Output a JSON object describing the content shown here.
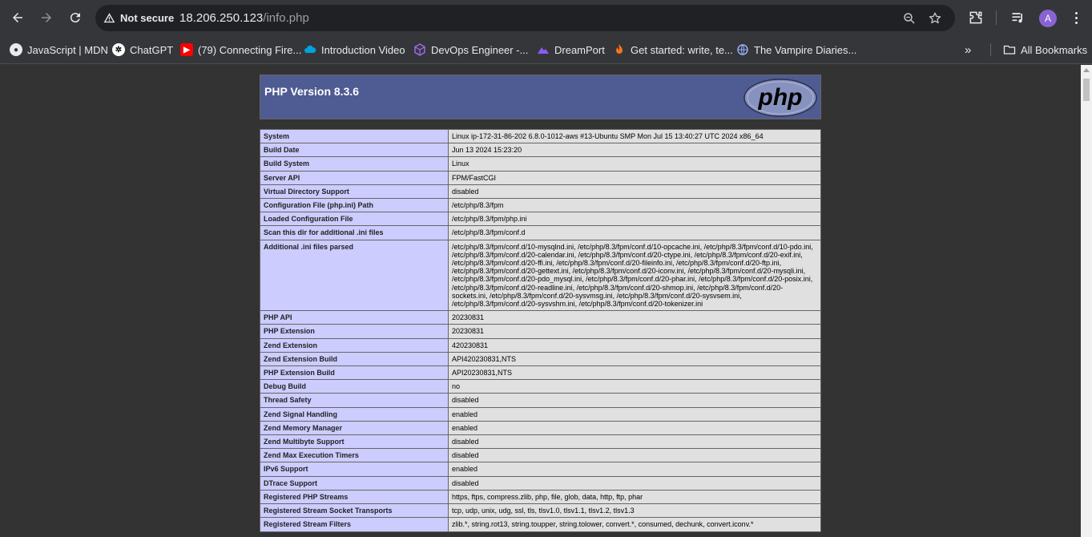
{
  "browser": {
    "security_label": "Not secure",
    "url_host": "18.206.250.123",
    "url_path": "/info.php",
    "avatar_letter": "A",
    "all_bookmarks_label": "All Bookmarks",
    "bookmarks": [
      {
        "label": "JavaScript | MDN",
        "icon": "mdn-icon"
      },
      {
        "label": "ChatGPT",
        "icon": "chatgpt-icon"
      },
      {
        "label": "(79) Connecting Fire...",
        "icon": "youtube-icon"
      },
      {
        "label": "Introduction Video",
        "icon": "cloud-icon"
      },
      {
        "label": "DevOps Engineer -...",
        "icon": "cube-icon"
      },
      {
        "label": "DreamPort",
        "icon": "mountain-icon"
      },
      {
        "label": "Get started: write, te...",
        "icon": "flame-icon"
      },
      {
        "label": "The Vampire Diaries...",
        "icon": "globe-icon"
      }
    ],
    "colors": {
      "chrome": "#35363a",
      "omnibox": "#202124",
      "page_bg": "#333333"
    }
  },
  "phpinfo": {
    "title": "PHP Version 8.3.6",
    "logo_text": "php",
    "colors": {
      "header": "#4f5b93",
      "key_cell": "#ccccff",
      "value_cell": "#e0e0e0"
    },
    "rows": [
      {
        "key": "System",
        "value": "Linux ip-172-31-86-202 6.8.0-1012-aws #13-Ubuntu SMP Mon Jul 15 13:40:27 UTC 2024 x86_64"
      },
      {
        "key": "Build Date",
        "value": "Jun 13 2024 15:23:20"
      },
      {
        "key": "Build System",
        "value": "Linux"
      },
      {
        "key": "Server API",
        "value": "FPM/FastCGI"
      },
      {
        "key": "Virtual Directory Support",
        "value": "disabled"
      },
      {
        "key": "Configuration File (php.ini) Path",
        "value": "/etc/php/8.3/fpm"
      },
      {
        "key": "Loaded Configuration File",
        "value": "/etc/php/8.3/fpm/php.ini"
      },
      {
        "key": "Scan this dir for additional .ini files",
        "value": "/etc/php/8.3/fpm/conf.d"
      },
      {
        "key": "Additional .ini files parsed",
        "value": "/etc/php/8.3/fpm/conf.d/10-mysqlnd.ini, /etc/php/8.3/fpm/conf.d/10-opcache.ini, /etc/php/8.3/fpm/conf.d/10-pdo.ini, /etc/php/8.3/fpm/conf.d/20-calendar.ini, /etc/php/8.3/fpm/conf.d/20-ctype.ini, /etc/php/8.3/fpm/conf.d/20-exif.ini, /etc/php/8.3/fpm/conf.d/20-ffi.ini, /etc/php/8.3/fpm/conf.d/20-fileinfo.ini, /etc/php/8.3/fpm/conf.d/20-ftp.ini, /etc/php/8.3/fpm/conf.d/20-gettext.ini, /etc/php/8.3/fpm/conf.d/20-iconv.ini, /etc/php/8.3/fpm/conf.d/20-mysqli.ini, /etc/php/8.3/fpm/conf.d/20-pdo_mysql.ini, /etc/php/8.3/fpm/conf.d/20-phar.ini, /etc/php/8.3/fpm/conf.d/20-posix.ini, /etc/php/8.3/fpm/conf.d/20-readline.ini, /etc/php/8.3/fpm/conf.d/20-shmop.ini, /etc/php/8.3/fpm/conf.d/20-sockets.ini, /etc/php/8.3/fpm/conf.d/20-sysvmsg.ini, /etc/php/8.3/fpm/conf.d/20-sysvsem.ini, /etc/php/8.3/fpm/conf.d/20-sysvshm.ini, /etc/php/8.3/fpm/conf.d/20-tokenizer.ini"
      },
      {
        "key": "PHP API",
        "value": "20230831"
      },
      {
        "key": "PHP Extension",
        "value": "20230831"
      },
      {
        "key": "Zend Extension",
        "value": "420230831"
      },
      {
        "key": "Zend Extension Build",
        "value": "API420230831,NTS"
      },
      {
        "key": "PHP Extension Build",
        "value": "API20230831,NTS"
      },
      {
        "key": "Debug Build",
        "value": "no"
      },
      {
        "key": "Thread Safety",
        "value": "disabled"
      },
      {
        "key": "Zend Signal Handling",
        "value": "enabled"
      },
      {
        "key": "Zend Memory Manager",
        "value": "enabled"
      },
      {
        "key": "Zend Multibyte Support",
        "value": "disabled"
      },
      {
        "key": "Zend Max Execution Timers",
        "value": "disabled"
      },
      {
        "key": "IPv6 Support",
        "value": "enabled"
      },
      {
        "key": "DTrace Support",
        "value": "disabled"
      },
      {
        "key": "Registered PHP Streams",
        "value": "https, ftps, compress.zlib, php, file, glob, data, http, ftp, phar"
      },
      {
        "key": "Registered Stream Socket Transports",
        "value": "tcp, udp, unix, udg, ssl, tls, tlsv1.0, tlsv1.1, tlsv1.2, tlsv1.3"
      },
      {
        "key": "Registered Stream Filters",
        "value": "zlib.*, string.rot13, string.toupper, string.tolower, convert.*, consumed, dechunk, convert.iconv.*"
      }
    ]
  }
}
